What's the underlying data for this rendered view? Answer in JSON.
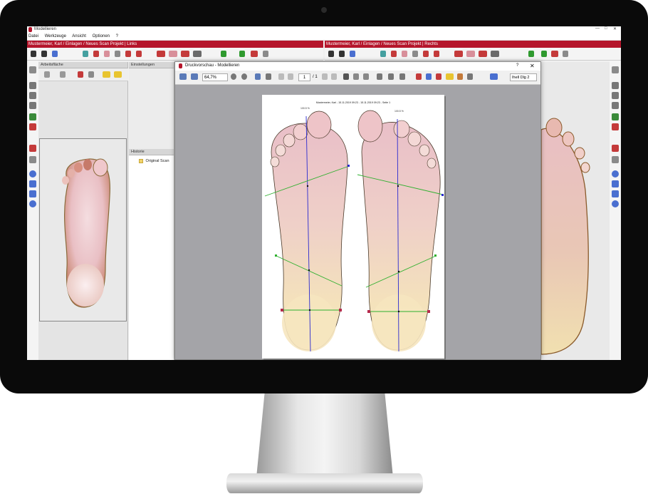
{
  "window": {
    "title": "Modellieren",
    "controls": {
      "minimize": "—",
      "maximize": "□",
      "close": "✕"
    }
  },
  "menu": [
    "Datei",
    "Werkzeuge",
    "Ansicht",
    "Optionen",
    "?"
  ],
  "panes": {
    "left_header": "Mustermeier, Karl / Einlagen / Neues Scan Projekt | Links",
    "right_header": "Mustermeier, Karl / Einlagen / Neues Scan Projekt | Rechts"
  },
  "panels": {
    "workspace_title": "Arbeitsfläche",
    "settings_title": "Einstellungen",
    "history_title": "Historie",
    "history_items": [
      "Original Scan"
    ]
  },
  "print_preview": {
    "title": "Druckvorschau - Modellieren",
    "help": "?",
    "close": "✕",
    "zoom": "64,7%",
    "page_current": "1",
    "page_total": "/ 1",
    "tab_label": "Ihell Dlg 2",
    "page_header": "Mustermeier, Karl - 15.11.2019 09:23 - 15.11.2019 09:23 - Seite 1",
    "left_foot_label": "100.5 %",
    "right_foot_label": "100.5 %"
  },
  "colors": {
    "accent": "#b5152b",
    "preview_bg": "#a4a4a8",
    "axis_line": "#2a2ad0",
    "cross_line": "#2fb02f"
  }
}
